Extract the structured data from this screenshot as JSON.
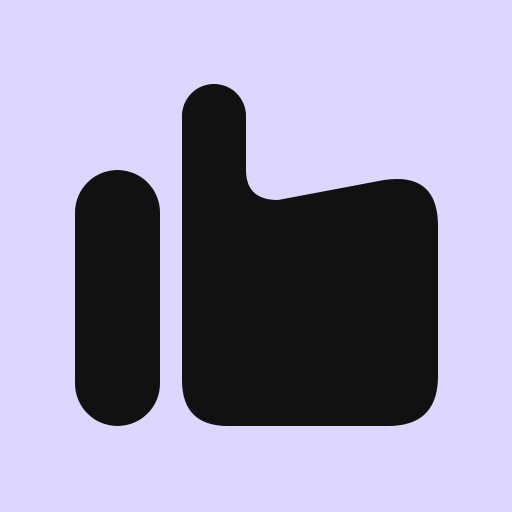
{
  "icon": {
    "name": "thumbs-up-icon"
  },
  "colors": {
    "background": "#DDD6FE",
    "glyph": "#111111"
  }
}
